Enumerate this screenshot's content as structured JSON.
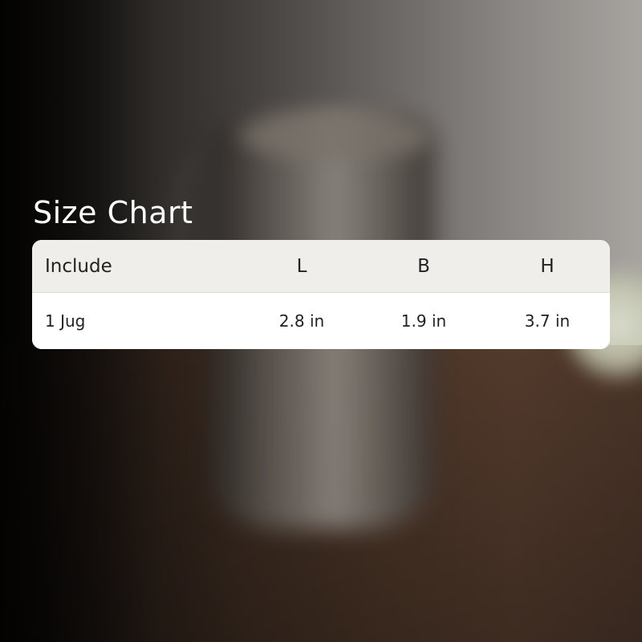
{
  "title": "Size Chart",
  "table": {
    "headers": [
      "Include",
      "L",
      "B",
      "H"
    ],
    "rows": [
      [
        "1 Jug",
        "2.8 in",
        "1.9 in",
        "3.7 in"
      ]
    ]
  },
  "colors": {
    "title_text": "#ffffff",
    "header_background": "#efeeea",
    "row_background": "#ffffff",
    "table_text": "#222222"
  }
}
